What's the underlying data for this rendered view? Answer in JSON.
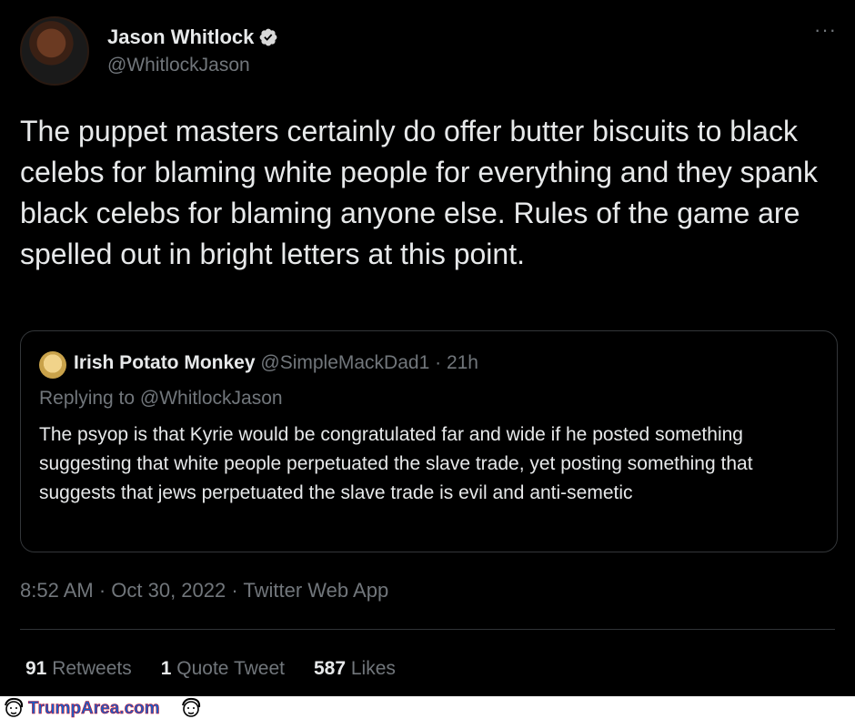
{
  "author": {
    "name": "Jason Whitlock",
    "handle": "@WhitlockJason",
    "verified": true,
    "avatar_icon": "user-avatar"
  },
  "more_label": "···",
  "tweet_text": "The puppet masters certainly do offer butter biscuits to black celebs for blaming white people for everything and they spank black celebs for blaming anyone else. Rules of the game are spelled out in bright letters at this point.",
  "quoted": {
    "name": "Irish Potato Monkey",
    "handle": "@SimpleMackDad1",
    "separator": " · ",
    "time": "21h",
    "replying_to": "Replying to @WhitlockJason",
    "text": "The psyop is that Kyrie would be congratulated far and wide if he posted something suggesting that white people perpetuated the slave trade,  yet posting something that suggests that jews perpetuated the slave trade is evil and anti-semetic"
  },
  "timestamp": "8:52 AM · Oct 30, 2022 · Twitter Web App",
  "stats": {
    "retweets_count": "91",
    "retweets_label": "Retweets",
    "quotes_count": "1",
    "quotes_label": "Quote Tweet",
    "likes_count": "587",
    "likes_label": "Likes"
  },
  "watermark": {
    "logo_text": "TrumpArea.com",
    "logo_icon": "trump-face-icon"
  },
  "colors": {
    "background": "#000000",
    "text": "#e7e9ea",
    "secondary": "#71767b",
    "border": "#333639",
    "verified_badge": "#d9d9d9"
  }
}
